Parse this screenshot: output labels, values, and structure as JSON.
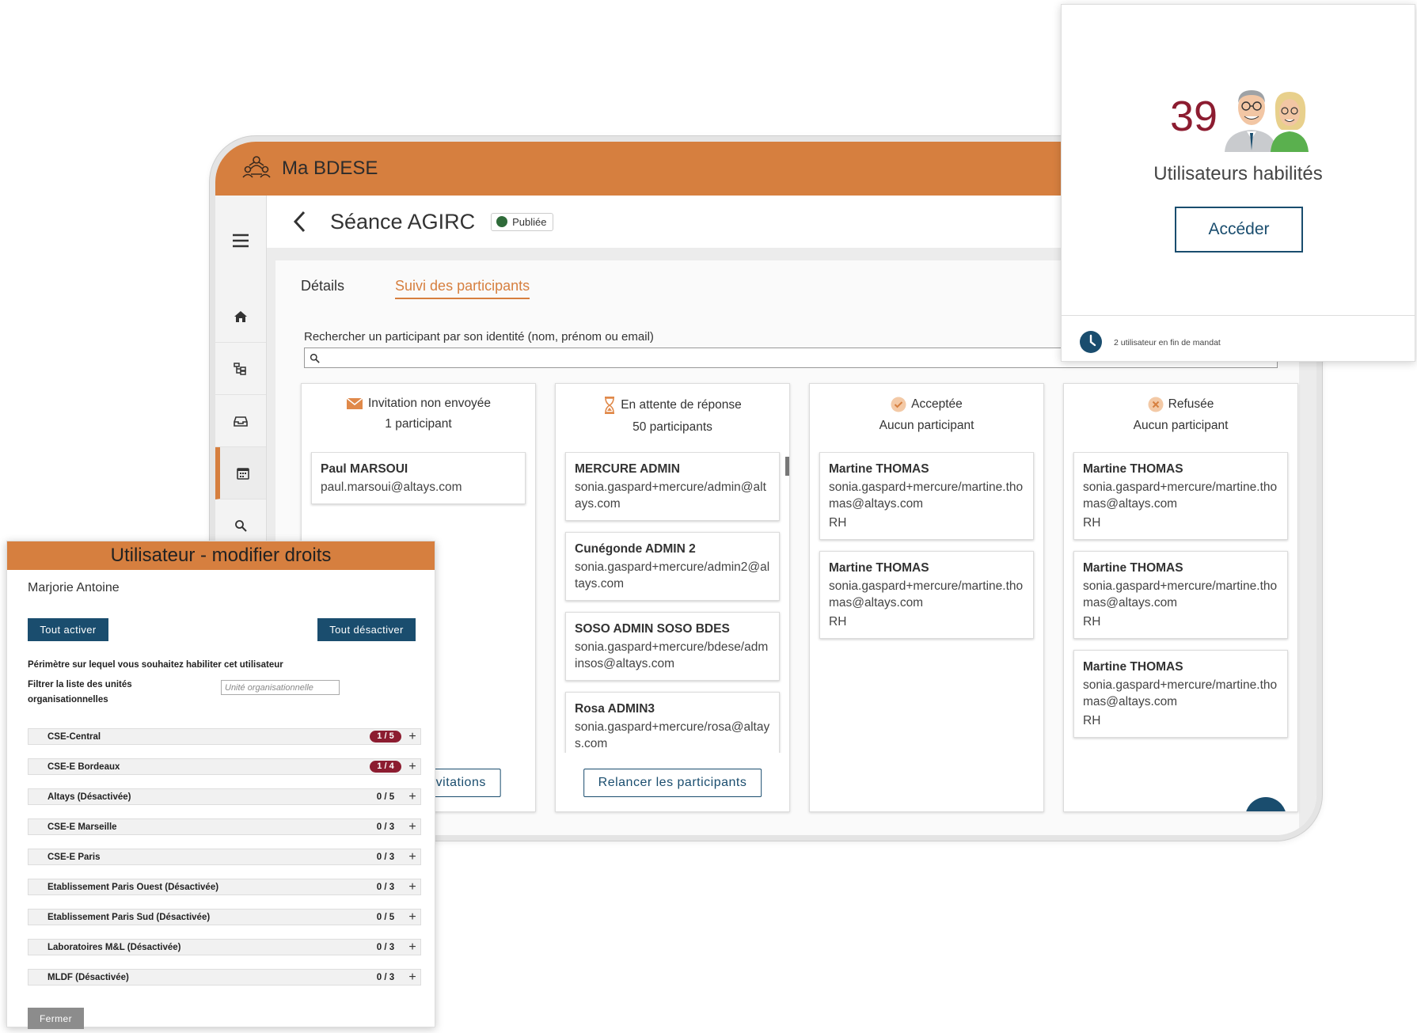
{
  "app": {
    "title": "Ma BDESE"
  },
  "page": {
    "title": "Séance AGIRC",
    "status": "Publiée"
  },
  "tabs": {
    "details": "Détails",
    "suivi": "Suivi des participants"
  },
  "search": {
    "label": "Rechercher un participant par son identité (nom, prénom ou email)",
    "placeholder": ""
  },
  "columns": [
    {
      "title": "Invitation non envoyée",
      "count": "1 participant",
      "icon": "envelope-icon",
      "cards": [
        {
          "name": "Paul MARSOUI",
          "email": "paul.marsoui@altays.com"
        }
      ],
      "button": "Envoyer les invitations"
    },
    {
      "title": "En attente de réponse",
      "count": "50 participants",
      "icon": "hourglass-icon",
      "cards": [
        {
          "name": "MERCURE ADMIN",
          "email": "sonia.gaspard+mercure/admin@altays.com"
        },
        {
          "name": "Cunégonde ADMIN 2",
          "email": "sonia.gaspard+mercure/admin2@altays.com"
        },
        {
          "name": "SOSO ADMIN SOSO BDES",
          "email": "sonia.gaspard+mercure/bdese/adminsos@altays.com"
        },
        {
          "name": "Rosa ADMIN3",
          "email": "sonia.gaspard+mercure/rosa@altays.com"
        }
      ],
      "button": "Relancer les participants"
    },
    {
      "title": "Acceptée",
      "count": "Aucun participant",
      "icon": "check-circle-icon",
      "cards": [
        {
          "name": "Martine THOMAS",
          "email": "sonia.gaspard+mercure/martine.thomas@altays.com",
          "role": "RH"
        },
        {
          "name": "Martine THOMAS",
          "email": "sonia.gaspard+mercure/martine.thomas@altays.com",
          "role": "RH"
        }
      ]
    },
    {
      "title": "Refusée",
      "count": "Aucun participant",
      "icon": "cross-circle-icon",
      "cards": [
        {
          "name": "Martine THOMAS",
          "email": "sonia.gaspard+mercure/martine.thomas@altays.com",
          "role": "RH"
        },
        {
          "name": "Martine THOMAS",
          "email": "sonia.gaspard+mercure/martine.thomas@altays.com",
          "role": "RH"
        },
        {
          "name": "Martine THOMAS",
          "email": "sonia.gaspard+mercure/martine.thomas@altays.com",
          "role": "RH"
        }
      ]
    }
  ],
  "stats": {
    "number": "39",
    "label": "Utilisateurs habilités",
    "button": "Accéder",
    "footer": "2 utilisateur en fin de mandat"
  },
  "modal": {
    "title": "Utilisateur - modifier droits",
    "user": "Marjorie Antoine",
    "activate": "Tout activer",
    "deactivate": "Tout désactiver",
    "scope_label": "Périmètre sur lequel vous souhaitez habiliter cet utilisateur",
    "filter_label": "Filtrer la liste des unités organisationnelles",
    "filter_placeholder": "Unité organisationnelle",
    "units": [
      {
        "name": "CSE-Central",
        "count": "1 / 5",
        "highlight": true
      },
      {
        "name": "CSE-E Bordeaux",
        "count": "1 / 4",
        "highlight": true
      },
      {
        "name": "Altays (Désactivée)",
        "count": "0 / 5"
      },
      {
        "name": "CSE-E Marseille",
        "count": "0 / 3"
      },
      {
        "name": "CSE-E Paris",
        "count": "0 / 3"
      },
      {
        "name": "Etablissement Paris Ouest (Désactivée)",
        "count": "0 / 3"
      },
      {
        "name": "Etablissement Paris Sud (Désactivée)",
        "count": "0 / 5"
      },
      {
        "name": "Laboratoires M&L (Désactivée)",
        "count": "0 / 3"
      },
      {
        "name": "MLDF (Désactivée)",
        "count": "0 / 3"
      }
    ],
    "close": "Fermer"
  },
  "colors": {
    "brand": "#d67f3f",
    "primary": "#1a4d6e",
    "accent": "#8c1c30",
    "status_published": "#2f6b3a"
  }
}
